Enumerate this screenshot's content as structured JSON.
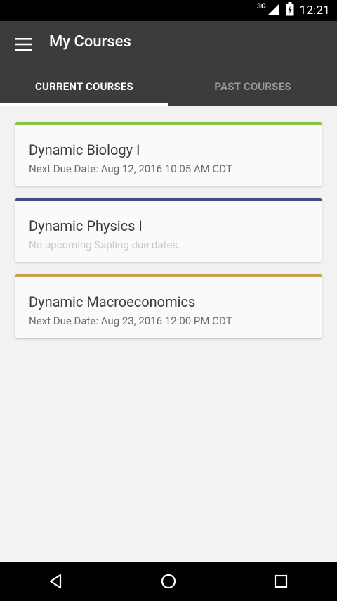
{
  "status_bar": {
    "network_label": "3G",
    "time": "12:21"
  },
  "app_bar": {
    "title": "My Courses",
    "menu_icon": "hamburger-menu-icon"
  },
  "tabs": [
    {
      "label": "CURRENT COURSES",
      "active": true
    },
    {
      "label": "PAST COURSES",
      "active": false
    }
  ],
  "courses": [
    {
      "name": "Dynamic Biology I",
      "due": "Next Due Date: Aug 12, 2016 10:05 AM CDT",
      "accent": "#8bc34a"
    },
    {
      "name": "Dynamic Physics I",
      "due": "No upcoming Sapling due dates.",
      "accent": "#3f4f7f"
    },
    {
      "name": "Dynamic Macroeconomics",
      "due": "Next Due Date: Aug 23, 2016 12:00 PM CDT",
      "accent": "#c5a04d"
    }
  ],
  "nav_bar": {
    "back_icon": "back-triangle-icon",
    "home_icon": "home-circle-icon",
    "recents_icon": "recents-square-icon"
  },
  "colors": {
    "app_bar": "#3c3c3c",
    "background": "#f2f2f2",
    "card": "#fafafa"
  }
}
